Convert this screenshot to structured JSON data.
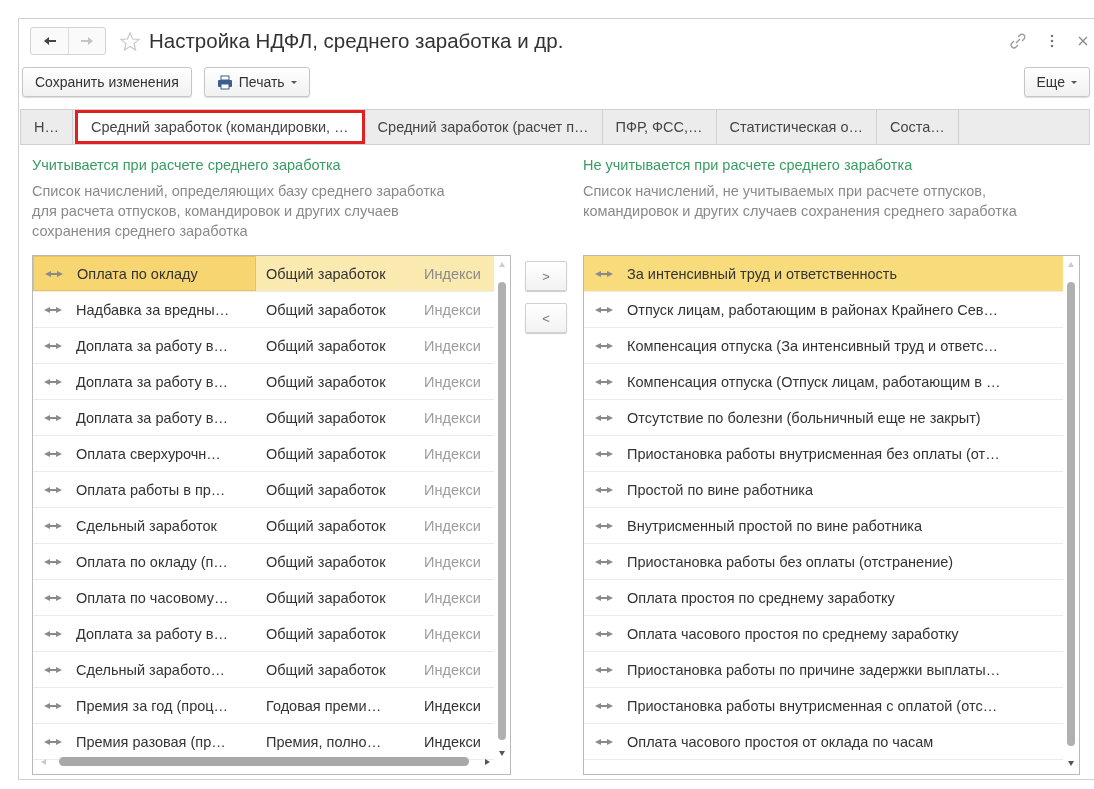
{
  "window": {
    "title": "Настройка НДФЛ, среднего заработка и др."
  },
  "toolbar": {
    "buttons": [
      {
        "label": "Сохранить изменения",
        "kind": "plain"
      },
      {
        "label": "Печать",
        "kind": "print"
      }
    ],
    "more_button": "Еще"
  },
  "tabs": [
    {
      "label": "Н…",
      "selected": false,
      "highlighted": false
    },
    {
      "label": "Средний заработок (командировки, …",
      "selected": true,
      "highlighted": true
    },
    {
      "label": "Средний заработок (расчет п…",
      "selected": false,
      "highlighted": false
    },
    {
      "label": "ПФР, ФСС,…",
      "selected": false,
      "highlighted": false
    },
    {
      "label": "Статистическая о…",
      "selected": false,
      "highlighted": false
    },
    {
      "label": "Соста…",
      "selected": false,
      "highlighted": false
    }
  ],
  "included": {
    "heading": "Учитывается при расчете среднего заработка",
    "description": "Список начислений, определяющих базу среднего заработка для расчета отпусков, командировок и других случаев сохранения среднего заработка",
    "rows": [
      {
        "name": "Оплата по окладу",
        "base": "Общий заработок",
        "indexing": "Индекси",
        "indexing_muted": true,
        "selected": true
      },
      {
        "name": "Надбавка за вредны…",
        "base": "Общий заработок",
        "indexing": "Индекси",
        "indexing_muted": true,
        "selected": false
      },
      {
        "name": "Доплата за работу в…",
        "base": "Общий заработок",
        "indexing": "Индекси",
        "indexing_muted": true,
        "selected": false
      },
      {
        "name": "Доплата за работу в…",
        "base": "Общий заработок",
        "indexing": "Индекси",
        "indexing_muted": true,
        "selected": false
      },
      {
        "name": "Доплата за работу в…",
        "base": "Общий заработок",
        "indexing": "Индекси",
        "indexing_muted": true,
        "selected": false
      },
      {
        "name": "Оплата сверхурочн…",
        "base": "Общий заработок",
        "indexing": "Индекси",
        "indexing_muted": true,
        "selected": false
      },
      {
        "name": "Оплата работы в пр…",
        "base": "Общий заработок",
        "indexing": "Индекси",
        "indexing_muted": true,
        "selected": false
      },
      {
        "name": "Сдельный заработок",
        "base": "Общий заработок",
        "indexing": "Индекси",
        "indexing_muted": true,
        "selected": false
      },
      {
        "name": "Оплата по окладу (п…",
        "base": "Общий заработок",
        "indexing": "Индекси",
        "indexing_muted": true,
        "selected": false
      },
      {
        "name": "Оплата по часовому…",
        "base": "Общий заработок",
        "indexing": "Индекси",
        "indexing_muted": true,
        "selected": false
      },
      {
        "name": "Доплата за работу в…",
        "base": "Общий заработок",
        "indexing": "Индекси",
        "indexing_muted": true,
        "selected": false
      },
      {
        "name": "Сдельный заработо…",
        "base": "Общий заработок",
        "indexing": "Индекси",
        "indexing_muted": true,
        "selected": false
      },
      {
        "name": "Премия за год (проц…",
        "base": "Годовая преми…",
        "indexing": "Индекси",
        "indexing_muted": false,
        "selected": false
      },
      {
        "name": "Премия разовая (пр…",
        "base": "Премия, полно…",
        "indexing": "Индекси",
        "indexing_muted": false,
        "selected": false
      }
    ]
  },
  "move_buttons": [
    ">",
    "<"
  ],
  "excluded": {
    "heading": "Не учитывается при расчете среднего заработка",
    "description": "Список начислений, не учитываемых при расчете отпусков, командировок и других случаев сохранения среднего заработка",
    "rows": [
      {
        "name": "За интенсивный труд и ответственность",
        "selected": true
      },
      {
        "name": "Отпуск лицам, работающим в районах Крайнего Сев…",
        "selected": false
      },
      {
        "name": "Компенсация отпуска (За интенсивный труд и ответс…",
        "selected": false
      },
      {
        "name": "Компенсация отпуска (Отпуск лицам, работающим в …",
        "selected": false
      },
      {
        "name": "Отсутствие по болезни (больничный еще не закрыт)",
        "selected": false
      },
      {
        "name": "Приостановка работы внутрисменная без оплаты (от…",
        "selected": false
      },
      {
        "name": "Простой по вине работника",
        "selected": false
      },
      {
        "name": "Внутрисменный простой по вине работника",
        "selected": false
      },
      {
        "name": "Приостановка работы без оплаты (отстранение)",
        "selected": false
      },
      {
        "name": "Оплата простоя по среднему заработку",
        "selected": false
      },
      {
        "name": "Оплата часового простоя по среднему заработку",
        "selected": false
      },
      {
        "name": "Приостановка работы по причине задержки выплаты…",
        "selected": false
      },
      {
        "name": "Приостановка работы внутрисменная с оплатой (отс…",
        "selected": false
      },
      {
        "name": "Оплата часового простоя от оклада по часам",
        "selected": false
      }
    ]
  }
}
